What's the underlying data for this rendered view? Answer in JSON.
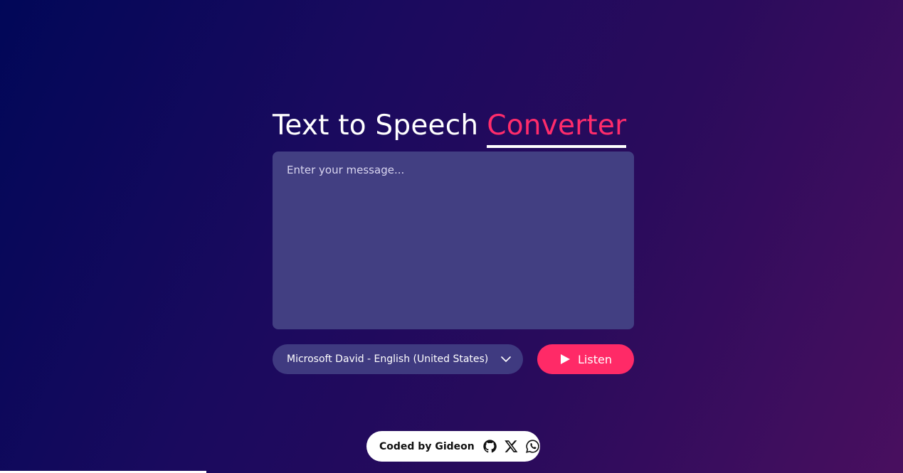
{
  "header": {
    "title_main": "Text to Speech",
    "title_accent": "Converter"
  },
  "message": {
    "placeholder": "Enter your message...",
    "value": ""
  },
  "voice_select": {
    "selected": "Microsoft David - English (United States)"
  },
  "listen_button": {
    "label": "Listen"
  },
  "footer": {
    "credit": "Coded by Gideon",
    "links": [
      {
        "icon": "github-icon"
      },
      {
        "icon": "x-icon"
      },
      {
        "icon": "whatsapp-icon"
      }
    ]
  },
  "colors": {
    "accent": "#ff2c6b",
    "input_bg": "#423f82",
    "bg_start": "#010758",
    "bg_end": "#490f5f"
  }
}
